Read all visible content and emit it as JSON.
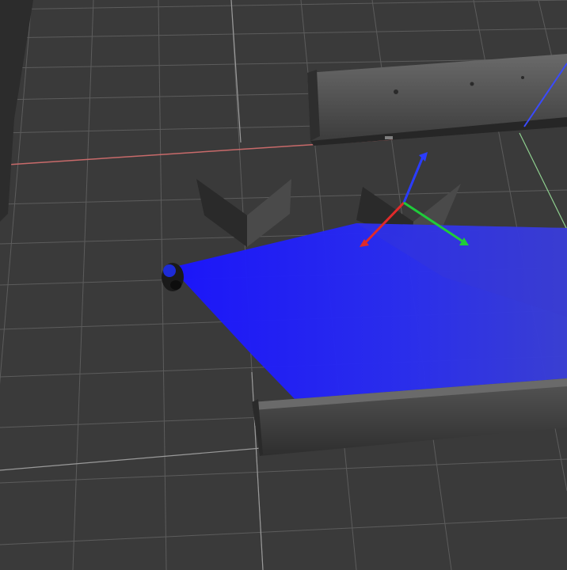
{
  "scene": {
    "background": "#3a3a3a",
    "grid_color": "#6e6e6e",
    "x_axis_color": "#c86464",
    "y_axis_color": "#7fd07f",
    "laser_scan_color": "#1a22ff",
    "frame_axes": {
      "x_color": "#e02a2a",
      "y_color": "#1fcc3a",
      "z_color": "#2a3cff"
    },
    "barrier_color": "#5a5a5a",
    "obstacle_color": "#3e3e3e",
    "robot_color": "#1a1a1a"
  },
  "icons": {
    "robot": "robot-sensor-icon"
  }
}
